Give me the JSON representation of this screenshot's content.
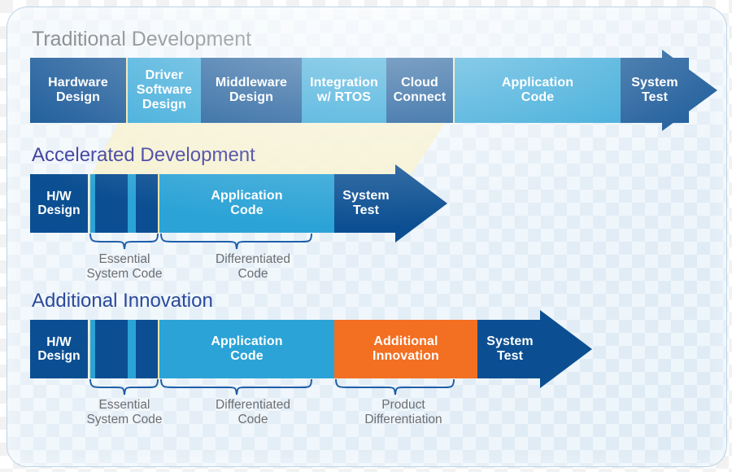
{
  "diagram": {
    "title_traditional": "Traditional Development",
    "title_accelerated": "Accelerated Development",
    "title_additional": "Additional Innovation",
    "colors": {
      "dark_blue": "#0b4f92",
      "light_blue": "#2ba3d6",
      "orange": "#f36f21",
      "divider_yellow": "#f0e5a8",
      "heading_gray": "#6d6e71",
      "heading_purple": "#3a3a9c",
      "brace_blue": "#1f5fa9",
      "card_border": "#bdd4e8"
    }
  },
  "rows": {
    "traditional": {
      "segments": [
        {
          "lines": [
            "Hardware",
            "Design"
          ],
          "color": "dark"
        },
        {
          "lines": [
            "Driver",
            "Software",
            "Design"
          ],
          "color": "light"
        },
        {
          "lines": [
            "Middleware",
            "Design"
          ],
          "color": "dark"
        },
        {
          "lines": [
            "Integration",
            "w/ RTOS"
          ],
          "color": "light"
        },
        {
          "lines": [
            "Cloud",
            "Connect"
          ],
          "color": "dark"
        },
        {
          "lines": [
            "Application",
            "Code"
          ],
          "color": "light"
        },
        {
          "lines": [
            "System",
            "Test"
          ],
          "color": "dark"
        }
      ]
    },
    "accelerated": {
      "segments": [
        {
          "lines": [
            "H/W",
            "Design"
          ],
          "color": "dark"
        },
        {
          "lines": [
            "Application",
            "Code"
          ],
          "color": "light"
        },
        {
          "lines": [
            "System",
            "Test"
          ],
          "color": "dark"
        }
      ],
      "braces": [
        {
          "lines": [
            "Essential",
            "System Code"
          ]
        },
        {
          "lines": [
            "Differentiated",
            "Code"
          ]
        }
      ]
    },
    "additional": {
      "segments": [
        {
          "lines": [
            "H/W",
            "Design"
          ],
          "color": "dark"
        },
        {
          "lines": [
            "Application",
            "Code"
          ],
          "color": "light"
        },
        {
          "lines": [
            "Additional",
            "Innovation"
          ],
          "color": "orange"
        },
        {
          "lines": [
            "System",
            "Test"
          ],
          "color": "dark"
        }
      ],
      "braces": [
        {
          "lines": [
            "Essential",
            "System Code"
          ]
        },
        {
          "lines": [
            "Differentiated",
            "Code"
          ]
        },
        {
          "lines": [
            "Product",
            "Differentiation"
          ]
        }
      ]
    }
  }
}
